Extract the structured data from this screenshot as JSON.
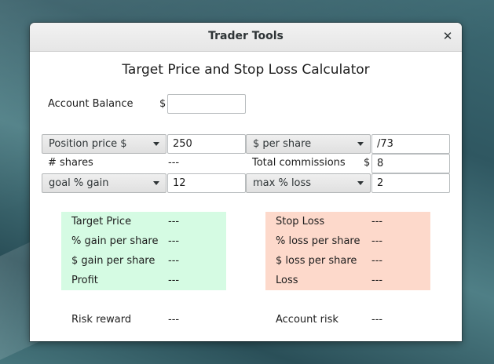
{
  "window": {
    "title": "Trader Tools",
    "close_glyph": "✕"
  },
  "calculator": {
    "heading": "Target Price and Stop Loss Calculator",
    "account_balance": {
      "label": "Account Balance",
      "currency": "$",
      "value": ""
    },
    "row1": {
      "left_combo": "Position price $",
      "left_value": "250",
      "right_combo": "$ per share",
      "right_value": "/73"
    },
    "row2": {
      "shares_label": "# shares",
      "shares_value": "---",
      "commissions_label": "Total commissions",
      "commissions_currency": "$",
      "commissions_value": "8"
    },
    "row3": {
      "left_combo": "goal % gain",
      "left_value": "12",
      "right_combo": "max % loss",
      "right_value": "2"
    }
  },
  "gain_panel": {
    "color": "#d5fbe3",
    "rows": [
      {
        "label": "Target Price",
        "value": "---"
      },
      {
        "label": "% gain per share",
        "value": "---"
      },
      {
        "label": "$ gain per share",
        "value": "---"
      },
      {
        "label": "Profit",
        "value": "---"
      }
    ]
  },
  "loss_panel": {
    "color": "#fdd9cb",
    "rows": [
      {
        "label": "Stop Loss",
        "value": "---"
      },
      {
        "label": "% loss per share",
        "value": "---"
      },
      {
        "label": "$ loss per share",
        "value": "---"
      },
      {
        "label": "Loss",
        "value": "---"
      }
    ]
  },
  "summary": {
    "risk_reward": {
      "label": "Risk reward",
      "value": "---"
    },
    "account_risk": {
      "label": "Account risk",
      "value": "---"
    }
  },
  "icons": {
    "close": "close-icon",
    "dropdown": "chevron-down-icon"
  }
}
